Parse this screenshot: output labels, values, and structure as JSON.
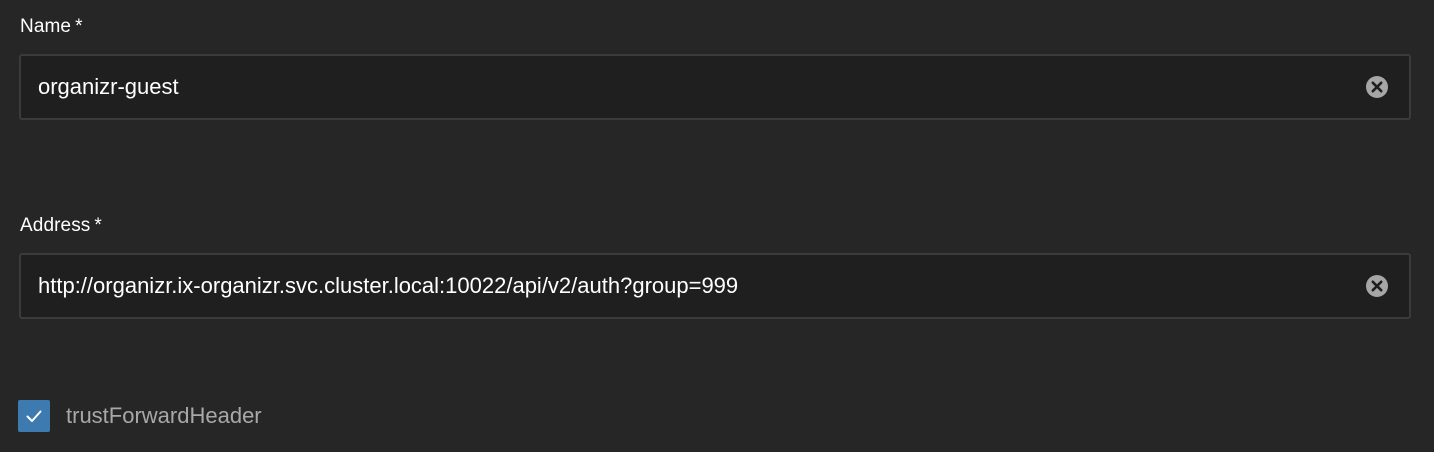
{
  "form": {
    "name": {
      "label": "Name",
      "required_mark": "*",
      "value": "organizr-guest"
    },
    "address": {
      "label": "Address",
      "required_mark": "*",
      "value": "http://organizr.ix-organizr.svc.cluster.local:10022/api/v2/auth?group=999"
    },
    "trust_forward_header": {
      "label": "trustForwardHeader",
      "checked": true
    }
  },
  "icons": {
    "clear": "clear-icon",
    "check": "checkmark-icon"
  },
  "colors": {
    "background": "#262626",
    "input_background": "#1f1f1f",
    "input_border": "#3b3b3b",
    "checkbox_accent": "#3d7ab0",
    "clear_icon": "#a6a6a6"
  }
}
